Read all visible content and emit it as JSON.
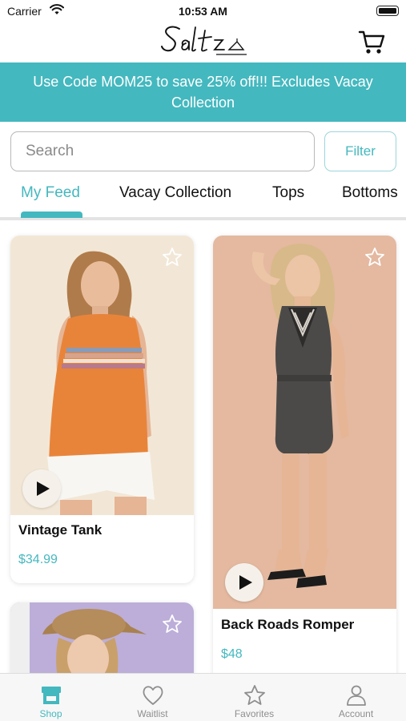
{
  "status_bar": {
    "carrier": "Carrier",
    "time": "10:53 AM"
  },
  "header": {
    "logo_text": "Salt",
    "cart_icon": "cart-icon"
  },
  "promo": {
    "text": "Use Code MOM25 to save 25% off!!! Excludes Vacay Collection"
  },
  "search": {
    "placeholder": "Search",
    "value": ""
  },
  "filter": {
    "label": "Filter"
  },
  "tabs": [
    {
      "label": "My Feed",
      "active": true
    },
    {
      "label": "Vacay Collection",
      "active": false
    },
    {
      "label": "Tops",
      "active": false
    },
    {
      "label": "Bottoms",
      "active": false
    }
  ],
  "products": [
    {
      "name": "Vintage Tank",
      "price": "$34.99",
      "has_video": true,
      "favorited": false
    },
    {
      "name": "Back Roads Romper",
      "price": "$48",
      "has_video": true,
      "favorited": false
    },
    {
      "name": "",
      "price": "",
      "has_video": false,
      "favorited": false
    }
  ],
  "tabbar": [
    {
      "label": "Shop",
      "icon": "shop-icon",
      "active": true
    },
    {
      "label": "Waitlist",
      "icon": "heart-icon",
      "active": false
    },
    {
      "label": "Favorites",
      "icon": "star-icon",
      "active": false
    },
    {
      "label": "Account",
      "icon": "person-icon",
      "active": false
    }
  ],
  "colors": {
    "accent": "#44b8bf",
    "divider": "#e3e3e3"
  }
}
